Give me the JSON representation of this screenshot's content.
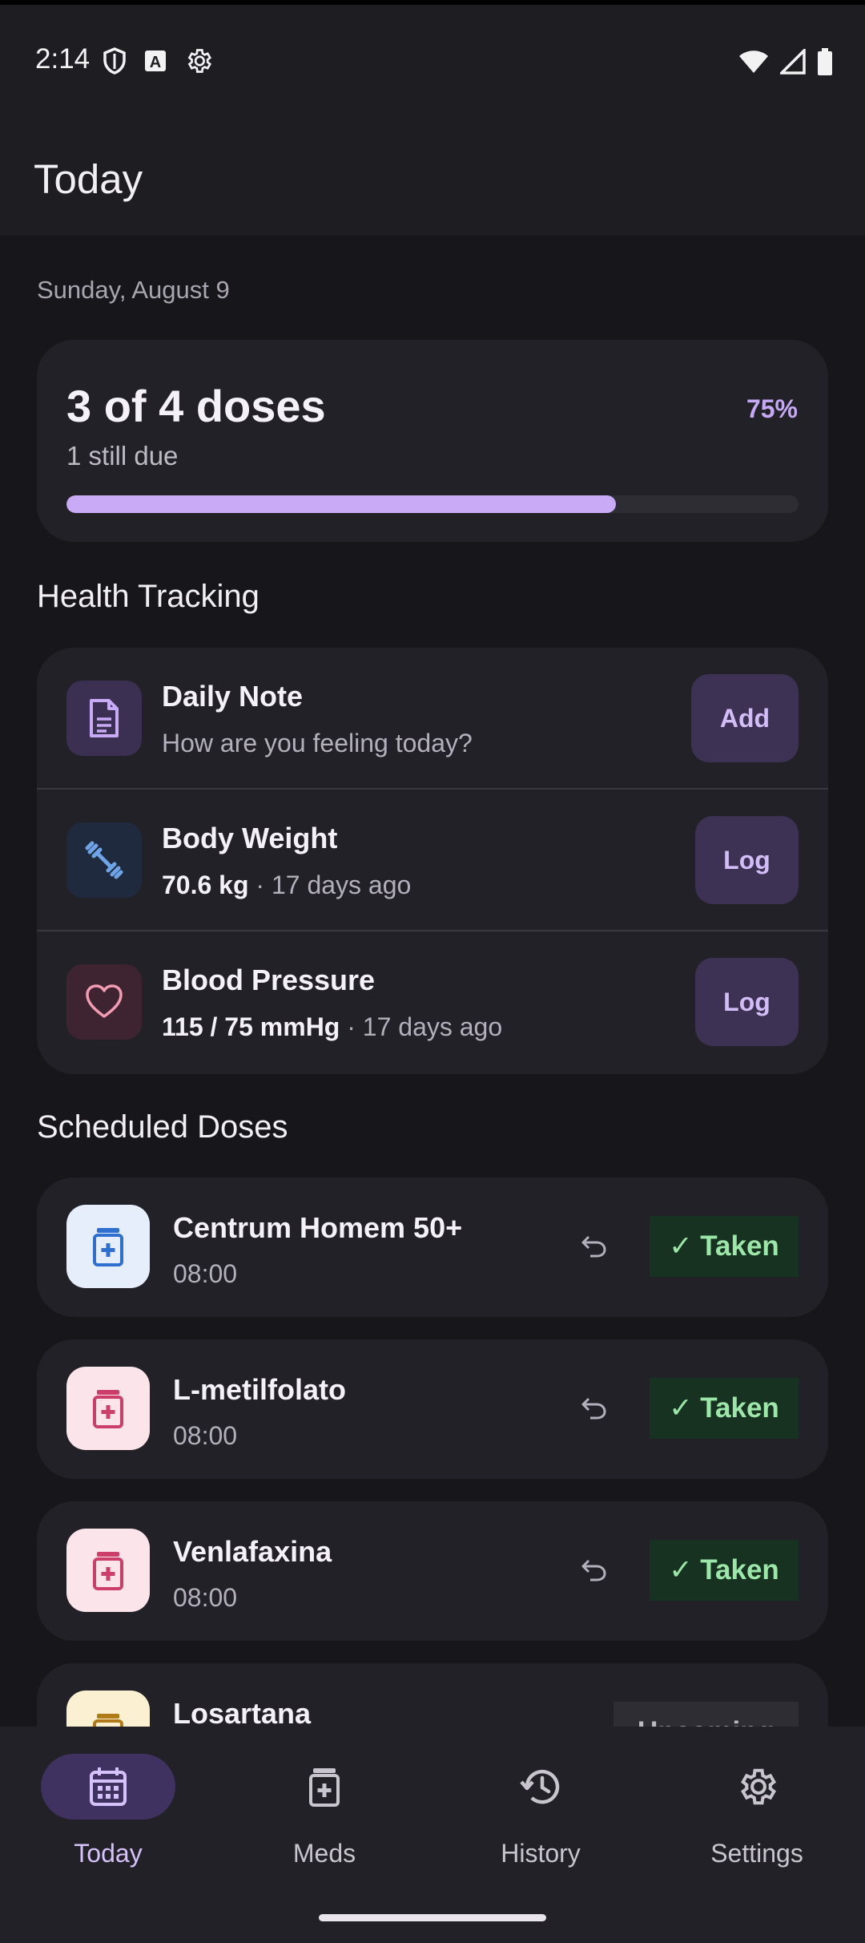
{
  "status_bar": {
    "time": "2:14",
    "icons_left": [
      "shield-icon",
      "font-icon",
      "gear-icon"
    ],
    "icons_right": [
      "wifi-icon",
      "signal-icon",
      "battery-icon"
    ]
  },
  "header": {
    "title": "Today"
  },
  "date_label": "Sunday, August 9",
  "summary": {
    "title": "3 of 4 doses",
    "subtitle": "1 still due",
    "percent_label": "75%",
    "progress": 0.75
  },
  "health": {
    "section_title": "Health Tracking",
    "items": [
      {
        "title": "Daily Note",
        "subtitle": "How are you feeling today?",
        "button": "Add",
        "icon": "note-icon"
      },
      {
        "title": "Body Weight",
        "value": "70.6 kg",
        "ago": " · 17 days ago",
        "button": "Log",
        "icon": "dumbbell-icon"
      },
      {
        "title": "Blood Pressure",
        "value": "115 / 75 mmHg",
        "ago": " · 17 days ago",
        "button": "Log",
        "icon": "heart-icon"
      }
    ]
  },
  "doses": {
    "section_title": "Scheduled Doses",
    "items": [
      {
        "name": "Centrum Homem 50+",
        "time": "08:00",
        "status": "✓ Taken",
        "icon": "pill-bottle-icon",
        "color": "#2f6fd0",
        "bg": "#e7eefb"
      },
      {
        "name": "L-metilfolato",
        "time": "08:00",
        "status": "✓ Taken",
        "icon": "pill-bottle-icon",
        "color": "#cc3f6b",
        "bg": "#fbe4ea"
      },
      {
        "name": "Venlafaxina",
        "time": "08:00",
        "status": "✓ Taken",
        "icon": "pill-bottle-icon",
        "color": "#cc3f6b",
        "bg": "#fbe4ea"
      },
      {
        "name": "Losartana",
        "time": "",
        "status": "Upcoming",
        "icon": "pill-bottle-icon",
        "color": "#b07a18",
        "bg": "#fbf0d2"
      }
    ]
  },
  "nav": {
    "items": [
      {
        "label": "Today",
        "icon": "calendar-icon",
        "active": true
      },
      {
        "label": "Meds",
        "icon": "pill-bottle-icon",
        "active": false
      },
      {
        "label": "History",
        "icon": "history-icon",
        "active": false
      },
      {
        "label": "Settings",
        "icon": "settings-icon",
        "active": false
      }
    ]
  },
  "colors": {
    "accent": "#c8aaf6",
    "taken_bg": "#173220",
    "taken_fg": "#9de6a9"
  }
}
